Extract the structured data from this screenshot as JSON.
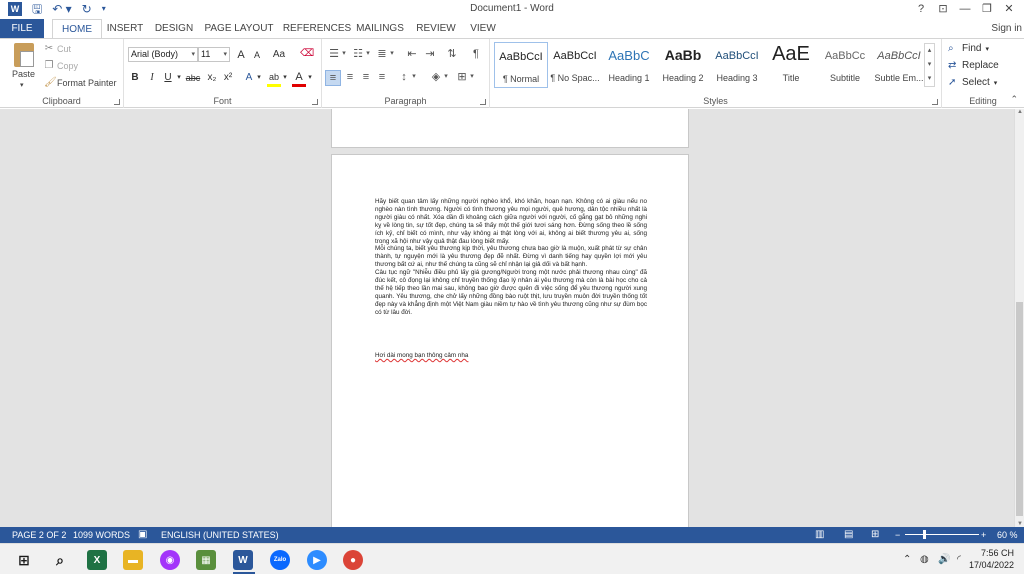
{
  "title_bar": {
    "title": "Document1 - Word",
    "help": "?",
    "ribbon_options": "⊡",
    "minimize": "—",
    "restore": "❐",
    "close": "✕"
  },
  "tabs": {
    "file": "FILE",
    "items": [
      "HOME",
      "INSERT",
      "DESIGN",
      "PAGE LAYOUT",
      "REFERENCES",
      "MAILINGS",
      "REVIEW",
      "VIEW"
    ],
    "active": "HOME",
    "sign_in": "Sign in"
  },
  "ribbon": {
    "clipboard": {
      "label": "Clipboard",
      "paste": "Paste",
      "cut": "Cut",
      "copy": "Copy",
      "format_painter": "Format Painter"
    },
    "font": {
      "label": "Font",
      "name": "Arial (Body)",
      "size": "11",
      "grow": "A",
      "shrink": "A",
      "case": "Aa",
      "bold": "B",
      "italic": "I",
      "underline": "U",
      "strike": "abc",
      "subscript": "x₂",
      "superscript": "x²",
      "effects": "A",
      "highlight": "ab",
      "font_color": "A",
      "highlight_color": "#ffff00",
      "font_color_value": "#e00000"
    },
    "paragraph": {
      "label": "Paragraph",
      "show_marks": "¶"
    },
    "styles": {
      "label": "Styles",
      "items": [
        {
          "sample": "AaBbCcI",
          "name": "¶ Normal"
        },
        {
          "sample": "AaBbCcI",
          "name": "¶ No Spac..."
        },
        {
          "sample": "AaBbC",
          "name": "Heading 1"
        },
        {
          "sample": "AaBb",
          "name": "Heading 2"
        },
        {
          "sample": "AaBbCcI",
          "name": "Heading 3"
        },
        {
          "sample": "AaE",
          "name": "Title"
        },
        {
          "sample": "AaBbCc",
          "name": "Subtitle"
        },
        {
          "sample": "AaBbCcI",
          "name": "Subtle Em..."
        }
      ]
    },
    "editing": {
      "label": "Editing",
      "find": "Find",
      "replace": "Replace",
      "select": "Select"
    }
  },
  "document": {
    "paragraphs": [
      "Hãy biết quan tâm lấy những người nghèo khổ, khó khăn, hoạn nạn. Không có ai giàu nếu no nghèo nàn tình thương. Người có tình thương yêu mọi người, quê hương, dân tộc nhiều nhất là người giàu có nhất. Xóa dần đi khoảng cách giữa người với người, cố gắng gạt bỏ những nghi kỵ về lòng tin, sự tốt đẹp, chúng ta sẽ thấy một thế giới tươi sáng hơn. Đừng sống theo lề sống ích kỷ, chỉ biết có mình, như vậy không ai thật lòng với ai, không ai biết thương yêu ai, sống trong xã hội như vậy quả thật đau lòng biết mấy.",
      "Mỗi chúng ta, biết yêu thương kịp thời, yêu thương chưa bao giờ là muộn, xuất phát từ sự chân thành, tự nguyện mới là yêu thương đẹp đẽ nhất. Đừng vì danh tiếng hay quyền lợi mới yêu thương bất cứ ai, như thế chúng ta cũng sẽ chỉ nhận lại giả dối và bất hạnh.",
      "Câu tục ngữ \"Nhiễu điều phủ lấy giá gương/Người trong một nước phải thương nhau cùng\" đã đúc kết, cô đọng lại không chỉ truyền thống đạo lý nhân ái yêu thương mà còn là bài học cho cả thế hệ tiếp theo lần mai sau, không bao giờ được quên đi việc sống để yêu thương người xung quanh. Yêu thương, che chở lấy những đồng bào ruột thịt, lưu truyền muôn đời truyền thống tốt đẹp này và khẳng định một Việt Nam giàu niềm tự hào về tình yêu thương cũng như sự đùm bọc có từ lâu đời."
    ],
    "closing": "Hơi dài mong bạn thông cảm nha"
  },
  "status_bar": {
    "page": "PAGE 2 OF 2",
    "words": "1099 WORDS",
    "language": "ENGLISH (UNITED STATES)",
    "zoom_out": "−",
    "zoom_in": "+",
    "zoom": "60 %",
    "zoom_fraction": 0.25
  },
  "taskbar": {
    "time": "7:56 CH",
    "date": "17/04/2022",
    "apps": [
      {
        "name": "start",
        "glyph": "⊞",
        "color": "#1a1a1a"
      },
      {
        "name": "search",
        "glyph": "⌕",
        "color": "#1a1a1a"
      },
      {
        "name": "excel",
        "glyph": "X",
        "color": "#1f7244"
      },
      {
        "name": "messenger",
        "glyph": "◉",
        "color": "#a334fa"
      },
      {
        "name": "file-explorer",
        "glyph": "▬",
        "color": "#e8b424"
      },
      {
        "name": "photos",
        "glyph": "▦",
        "color": "#5a8f3d"
      },
      {
        "name": "word",
        "glyph": "W",
        "color": "#2b579a"
      },
      {
        "name": "zalo",
        "glyph": "Zalo",
        "color": "#0a68fe"
      },
      {
        "name": "zoom",
        "glyph": "▶",
        "color": "#2d8cff"
      },
      {
        "name": "chrome",
        "glyph": "●",
        "color": "#db4437"
      }
    ]
  }
}
